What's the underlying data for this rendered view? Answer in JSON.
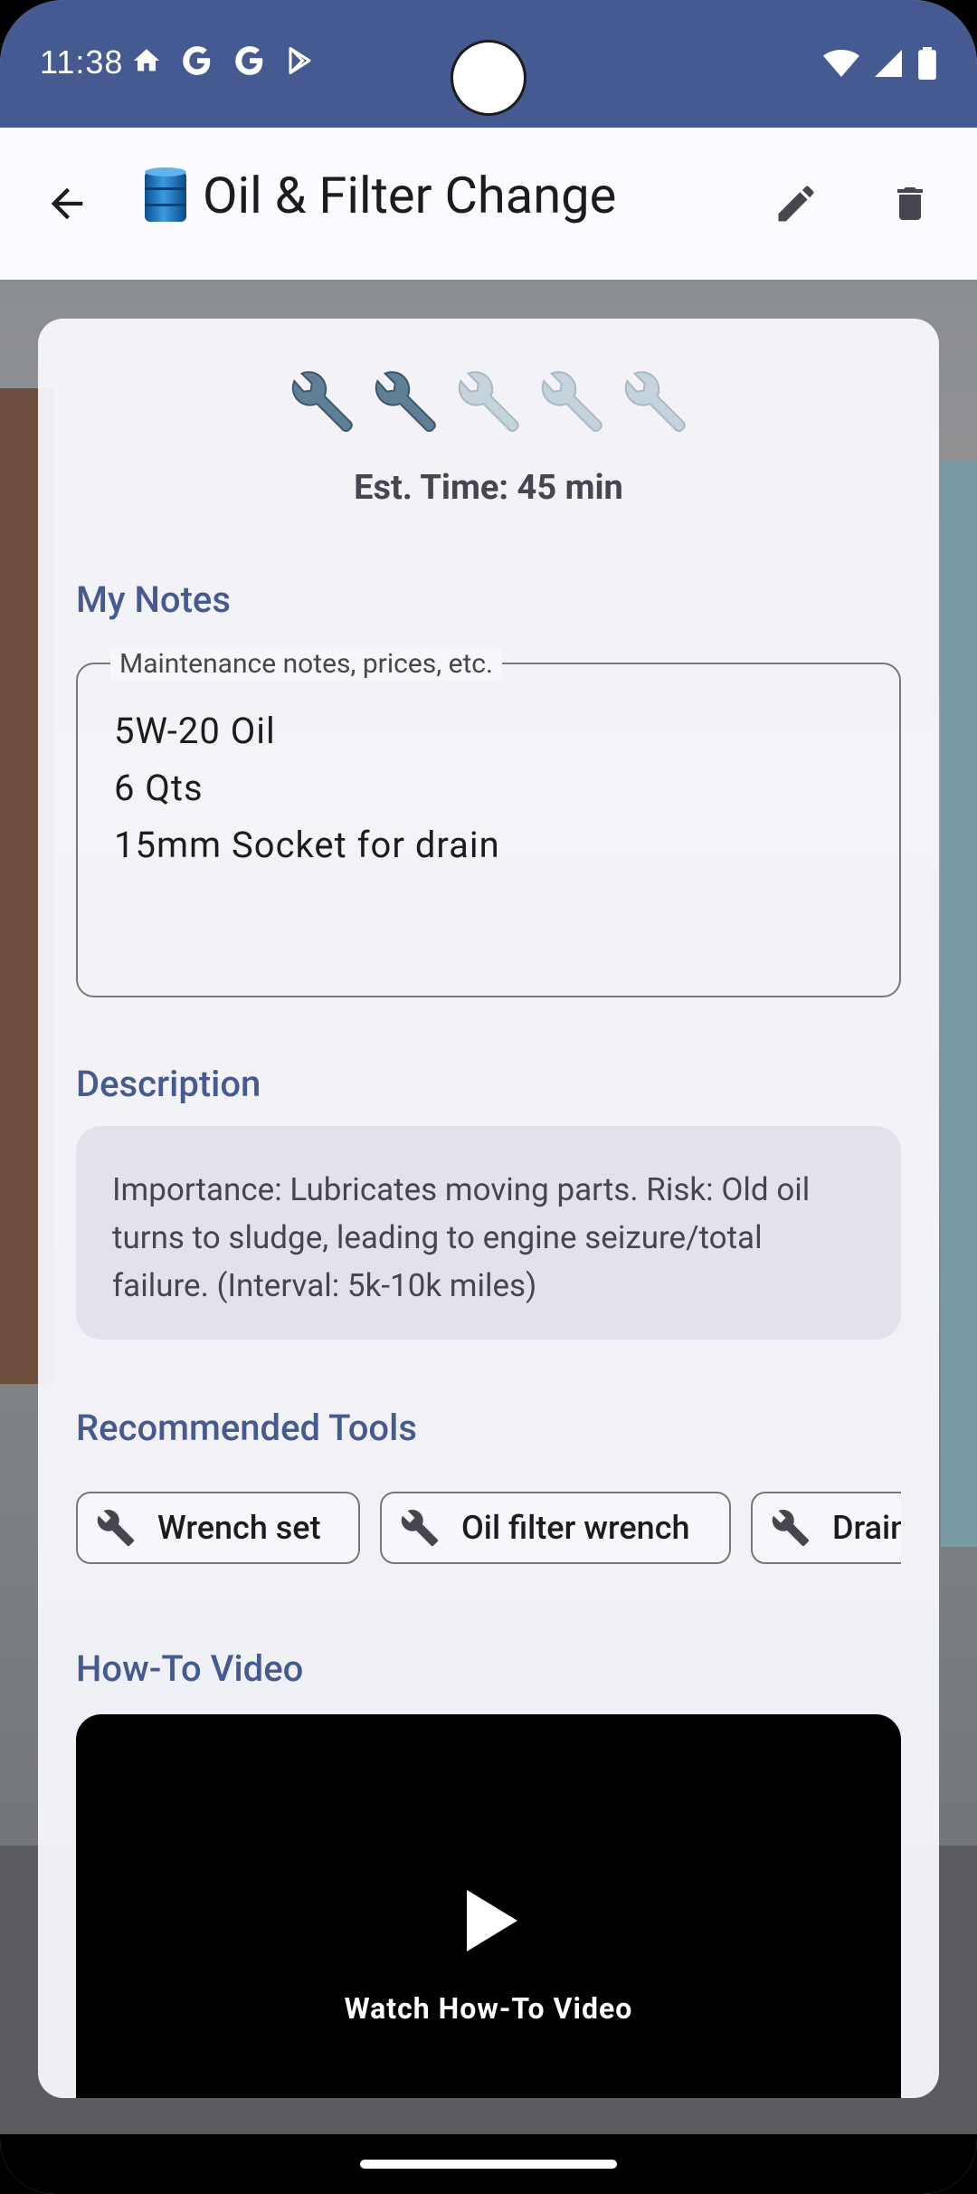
{
  "status_bar": {
    "time": "11:38"
  },
  "app_bar": {
    "title": "Oil & Filter Change",
    "title_icon": "oil-drum-icon",
    "back_icon": "arrow-back-icon",
    "edit_icon": "pencil-icon",
    "delete_icon": "trash-icon"
  },
  "difficulty": {
    "rating": 2,
    "max": 5,
    "icon": "wrench-icon"
  },
  "est_time": "Est. Time: 45 min",
  "notes": {
    "section_title": "My Notes",
    "label": "Maintenance notes, prices, etc.",
    "value": "5W-20 Oil\n6 Qts\n15mm Socket for drain"
  },
  "description": {
    "section_title": "Description",
    "text": "Importance: Lubricates moving parts. Risk: Old oil turns to sludge, leading to engine seizure/total failure. (Interval: 5k-10k miles)"
  },
  "tools": {
    "section_title": "Recommended Tools",
    "chips": [
      {
        "label": "Wrench set"
      },
      {
        "label": "Oil filter wrench"
      },
      {
        "label": "Drain"
      }
    ]
  },
  "video": {
    "section_title": "How-To Video",
    "label": "Watch How-To Video"
  },
  "colors": {
    "primary": "#465a92",
    "status_bar": "#465a92",
    "surface": "#fbfaff",
    "description_bg": "#e2e2ea"
  }
}
